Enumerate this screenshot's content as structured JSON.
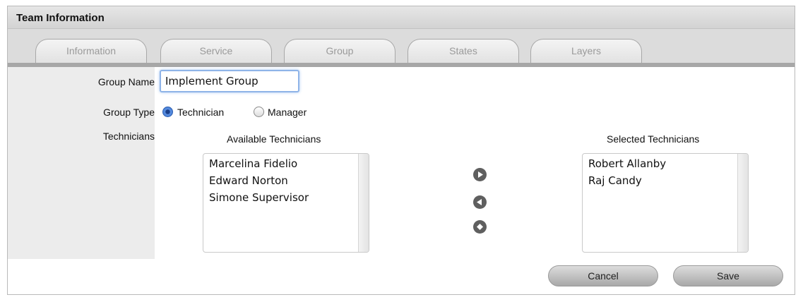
{
  "panel": {
    "title": "Team Information"
  },
  "tabs": [
    {
      "label": "Information"
    },
    {
      "label": "Service"
    },
    {
      "label": "Group"
    },
    {
      "label": "States"
    },
    {
      "label": "Layers"
    }
  ],
  "form": {
    "group_name_label": "Group Name",
    "group_name_value": "Implement Group",
    "group_type_label": "Group Type",
    "group_type_options": [
      {
        "label": "Technician",
        "selected": true
      },
      {
        "label": "Manager",
        "selected": false
      }
    ],
    "technicians_label": "Technicians"
  },
  "available": {
    "heading": "Available Technicians",
    "items": [
      "Marcelina Fidelio",
      "Edward Norton",
      "Simone Supervisor"
    ]
  },
  "selected": {
    "heading": "Selected Technicians",
    "items": [
      "Robert Allanby",
      "Raj Candy"
    ]
  },
  "buttons": {
    "cancel": "Cancel",
    "save": "Save"
  },
  "icons": [
    "move-right-icon",
    "move-left-icon",
    "move-all-icon"
  ]
}
